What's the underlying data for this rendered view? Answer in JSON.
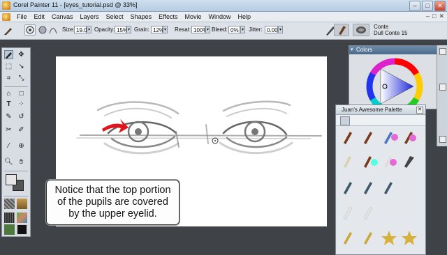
{
  "window": {
    "title": "Corel Painter 11 - [eyes_tutorial.psd @ 33%]",
    "min": "–",
    "max": "□",
    "close": "✕"
  },
  "menu": {
    "items": [
      "File",
      "Edit",
      "Canvas",
      "Layers",
      "Select",
      "Shapes",
      "Effects",
      "Movie",
      "Window",
      "Help"
    ],
    "right": [
      "–",
      "□",
      "✕"
    ]
  },
  "property_bar": {
    "size_label": "Size:",
    "size_value": "19.0",
    "opacity_label": "Opacity:",
    "opacity_value": "15%",
    "grain_label": "Grain:",
    "grain_value": "12%",
    "resat_label": "Resat:",
    "resat_value": "100%",
    "bleed_label": "Bleed:",
    "bleed_value": "0%",
    "jitter_label": "Jitter:",
    "jitter_value": "0.00",
    "brush_category": "Conte",
    "brush_variant": "Dull Conte 15"
  },
  "callout": {
    "text": "Notice that the top portion of the pupils are covered by the upper eyelid."
  },
  "colors_panel": {
    "title": "Colors"
  },
  "palette": {
    "title": "Juan's Awesome Palette",
    "close": "✕"
  },
  "toolbox": {
    "tools": [
      "brush-tool",
      "layer-adjuster-tool",
      "rectangle-select-tool",
      "lasso-tool",
      "crop-tool",
      "transform-tool",
      "text-tool",
      "shape-tool",
      "magic-wand-tool",
      "pen-tool",
      "paint-bucket-tool",
      "eraser-tool",
      "dropper-tool",
      "clone-tool",
      "magnifier-tool",
      "grabber-tool"
    ],
    "main_color": "#e6e6e6",
    "additional_color": "#545454"
  },
  "colors": {
    "accent": "#4a6988",
    "workspace": "#3f4347",
    "arrow": "#e0151b"
  }
}
